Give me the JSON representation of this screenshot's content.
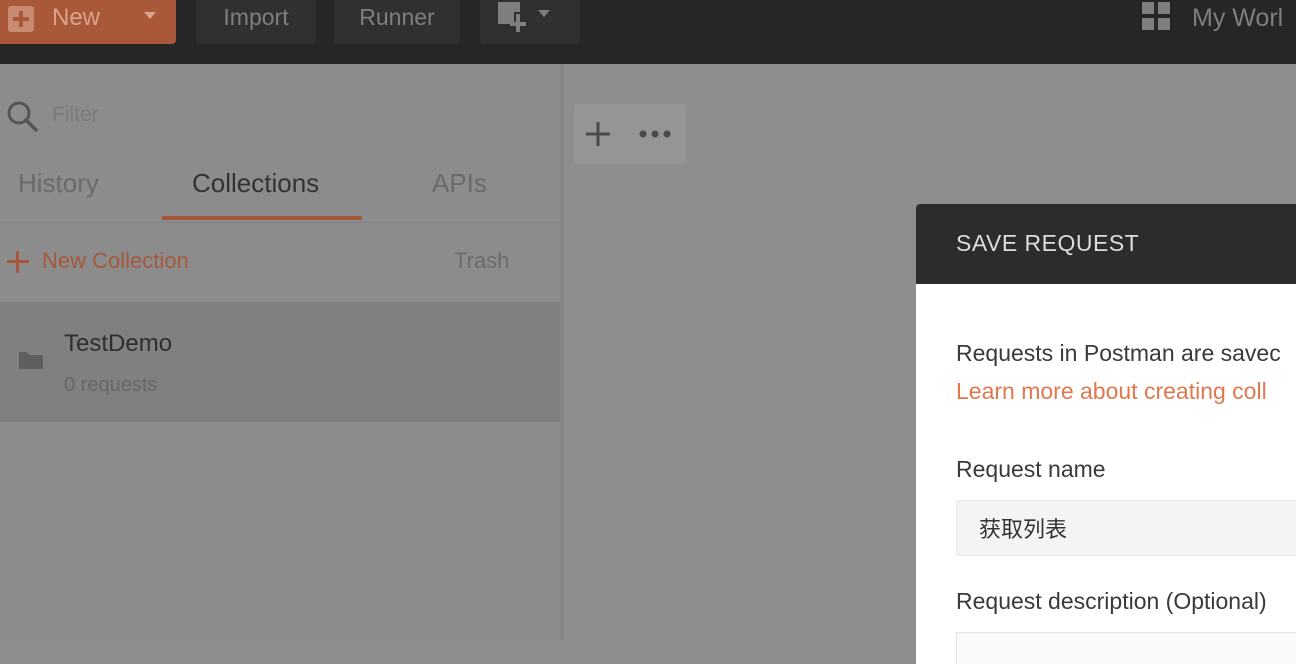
{
  "topbar": {
    "new_label": "New",
    "import_label": "Import",
    "runner_label": "Runner",
    "workspace_label": "My Worl"
  },
  "sidebar": {
    "filter_placeholder": "Filter",
    "tabs": [
      {
        "label": "History"
      },
      {
        "label": "Collections"
      },
      {
        "label": "APIs"
      }
    ],
    "active_tab": "Collections",
    "new_collection_label": "New Collection",
    "trash_label": "Trash",
    "collections": [
      {
        "name": "TestDemo",
        "count": "0 requests"
      }
    ]
  },
  "modal": {
    "title": "SAVE REQUEST",
    "intro": "Requests in Postman are savec",
    "link": "Learn more about creating coll",
    "name_label": "Request name",
    "name_value": "获取列表",
    "desc_label": "Request description (Optional)"
  },
  "colors": {
    "accent": "#f26b3a",
    "topbar_bg": "#262626",
    "modal_header_bg": "#2c2c2c",
    "overlay_dim": "#8e8e8e"
  },
  "icons": [
    "plus-icon",
    "caret-down-icon",
    "new-window-icon",
    "workspace-grid-icon",
    "search-icon",
    "folder-icon",
    "add-tab-icon",
    "more-icon"
  ]
}
